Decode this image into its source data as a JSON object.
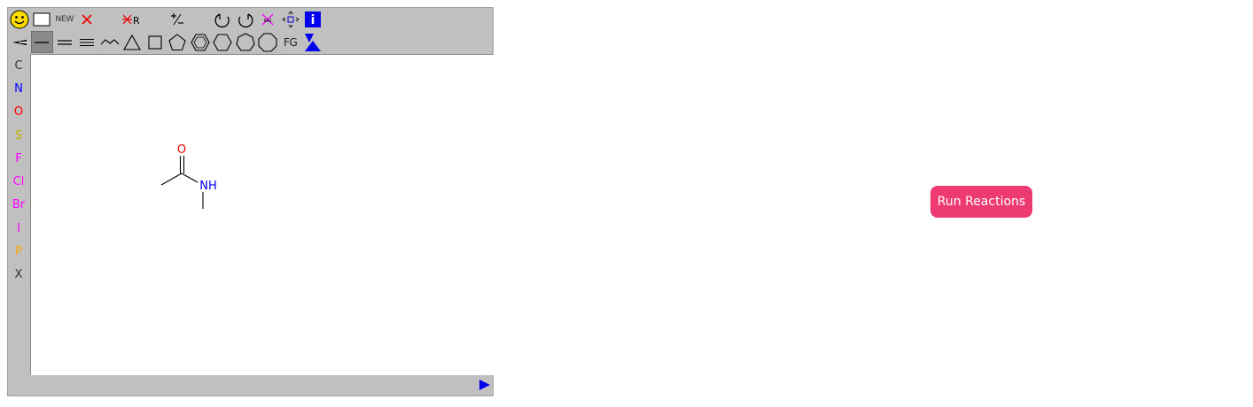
{
  "toolbar": {
    "new_label": "NEW",
    "fg_label": "FG",
    "info_label": "i",
    "remove_r_label": "R",
    "charge_label": "+/-"
  },
  "atoms": [
    {
      "label": "C",
      "color": "#333333"
    },
    {
      "label": "N",
      "color": "#0000ff"
    },
    {
      "label": "O",
      "color": "#ff0000"
    },
    {
      "label": "S",
      "color": "#c8b400"
    },
    {
      "label": "F",
      "color": "#ff00ff"
    },
    {
      "label": "Cl",
      "color": "#ff00ff"
    },
    {
      "label": "Br",
      "color": "#ff00ff"
    },
    {
      "label": "I",
      "color": "#ff00ff"
    },
    {
      "label": "P",
      "color": "#ffa500"
    },
    {
      "label": "X",
      "color": "#333333"
    }
  ],
  "molecule": {
    "oxygen_label": "O",
    "nitrogen_label": "NH",
    "oxygen_color": "#ff0000",
    "nitrogen_color": "#0000ff"
  },
  "run_button": {
    "label": "Run Reactions",
    "color": "#ee3a72"
  }
}
